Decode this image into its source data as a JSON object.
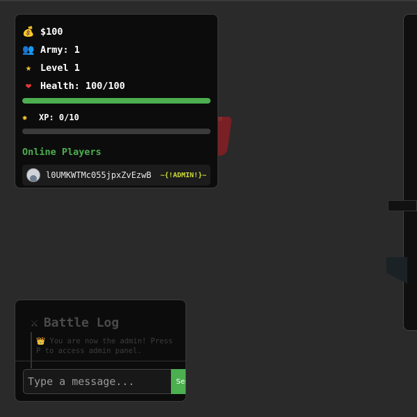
{
  "stats": {
    "money": "$100",
    "army": "Army: 1",
    "level": "Level 1",
    "health": "Health: 100/100",
    "health_fraction": 1.0,
    "xp": "XP: 0/10",
    "xp_fraction": 0.0
  },
  "icons": {
    "money": "money-bag-icon",
    "army": "people-icon",
    "level": "star-icon",
    "health": "heart-icon",
    "xp": "sparkle-star-icon",
    "battle": "crossed-swords-icon"
  },
  "online": {
    "title": "Online Players",
    "players": [
      {
        "name": "l0UMKWTMc055jpxZvEzwB",
        "badge": "~{!ADMIN!}~"
      }
    ]
  },
  "battle_log": {
    "title": "Battle Log",
    "message": "👑 You are now the admin! Press P to access admin panel."
  },
  "chat": {
    "placeholder": "Type a message...",
    "send_label": "Send"
  },
  "colors": {
    "accent": "#4caf50",
    "admin_badge": "#cddc39",
    "panel_bg": "#0c0c0c",
    "world_bg": "#2a2a2b"
  }
}
